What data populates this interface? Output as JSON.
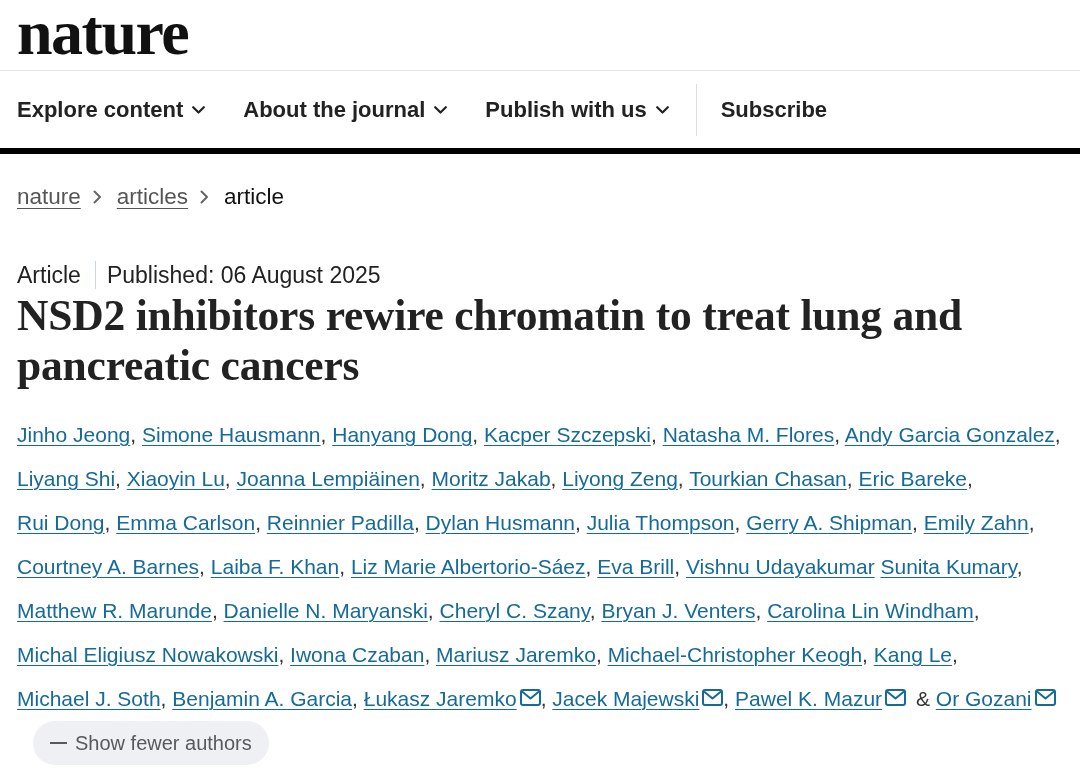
{
  "logo": "nature",
  "nav": [
    {
      "label": "Explore content",
      "kind": "menu"
    },
    {
      "label": "About the journal",
      "kind": "menu"
    },
    {
      "label": "Publish with us",
      "kind": "menu"
    },
    {
      "label": "Subscribe",
      "kind": "link"
    }
  ],
  "breadcrumbs": [
    {
      "label": "nature",
      "current": false
    },
    {
      "label": "articles",
      "current": false
    },
    {
      "label": "article",
      "current": true
    }
  ],
  "article": {
    "type": "Article",
    "published": "Published: 06 August 2025",
    "title": "NSD2 inhibitors rewire chromatin to treat lung and pancreatic cancers",
    "authors": [
      {
        "name": "Jinho Jeong",
        "email": false,
        "separator": ","
      },
      {
        "name": "Simone Hausmann",
        "email": false,
        "separator": ","
      },
      {
        "name": "Hanyang Dong",
        "email": false,
        "separator": ","
      },
      {
        "name": "Kacper Szczepski",
        "email": false,
        "separator": ","
      },
      {
        "name": "Natasha M. Flores",
        "email": false,
        "separator": ","
      },
      {
        "name": "Andy Garcia Gonzalez",
        "email": false,
        "separator": ","
      },
      {
        "name": "Liyang Shi",
        "email": false,
        "separator": ","
      },
      {
        "name": "Xiaoyin Lu",
        "email": false,
        "separator": ","
      },
      {
        "name": "Joanna Lempiäinen",
        "email": false,
        "separator": ","
      },
      {
        "name": "Moritz Jakab",
        "email": false,
        "separator": ","
      },
      {
        "name": "Liyong Zeng",
        "email": false,
        "separator": ","
      },
      {
        "name": "Tourkian Chasan",
        "email": false,
        "separator": ","
      },
      {
        "name": "Eric Bareke",
        "email": false,
        "separator": ","
      },
      {
        "name": "Rui Dong",
        "email": false,
        "separator": ","
      },
      {
        "name": "Emma Carlson",
        "email": false,
        "separator": ","
      },
      {
        "name": "Reinnier Padilla",
        "email": false,
        "separator": ","
      },
      {
        "name": "Dylan Husmann",
        "email": false,
        "separator": ","
      },
      {
        "name": "Julia Thompson",
        "email": false,
        "separator": ","
      },
      {
        "name": "Gerry A. Shipman",
        "email": false,
        "separator": ","
      },
      {
        "name": "Emily Zahn",
        "email": false,
        "separator": ","
      },
      {
        "name": "Courtney A. Barnes",
        "email": false,
        "separator": ","
      },
      {
        "name": "Laiba F. Khan",
        "email": false,
        "separator": ","
      },
      {
        "name": "Liz Marie Albertorio-Sáez",
        "email": false,
        "separator": ","
      },
      {
        "name": "Eva Brill",
        "email": false,
        "separator": ","
      },
      {
        "name": "Vishnu Udayakumar",
        "email": false
      },
      {
        "name": "Sunita Kumary",
        "email": false,
        "separator": ","
      },
      {
        "name": "Matthew R. Marunde",
        "email": false,
        "separator": ","
      },
      {
        "name": "Danielle N. Maryanski",
        "email": false,
        "separator": ","
      },
      {
        "name": "Cheryl C. Szany",
        "email": false,
        "separator": ","
      },
      {
        "name": "Bryan J. Venters",
        "email": false,
        "separator": ","
      },
      {
        "name": "Carolina Lin Windham",
        "email": false,
        "separator": ","
      },
      {
        "name": "Michal Eligiusz Nowakowski",
        "email": false,
        "separator": ","
      },
      {
        "name": "Iwona Czaban",
        "email": false,
        "separator": ","
      },
      {
        "name": "Mariusz Jaremko",
        "email": false,
        "separator": ","
      },
      {
        "name": "Michael-Christopher Keogh",
        "email": false,
        "separator": ","
      },
      {
        "name": "Kang Le",
        "email": false,
        "separator": ","
      },
      {
        "name": "Michael J. Soth",
        "email": false,
        "separator": ","
      },
      {
        "name": "Benjamin A. Garcia",
        "email": false,
        "separator": ","
      },
      {
        "name": "Łukasz Jaremko",
        "email": true,
        "separator": ","
      },
      {
        "name": "Jacek Majewski",
        "email": true,
        "separator": ","
      },
      {
        "name": "Pawel K. Mazur",
        "email": true,
        "separator": "&"
      },
      {
        "name": "Or Gozani",
        "email": true
      }
    ],
    "author_toggle": {
      "label": "Show fewer authors",
      "expanded": true
    }
  }
}
